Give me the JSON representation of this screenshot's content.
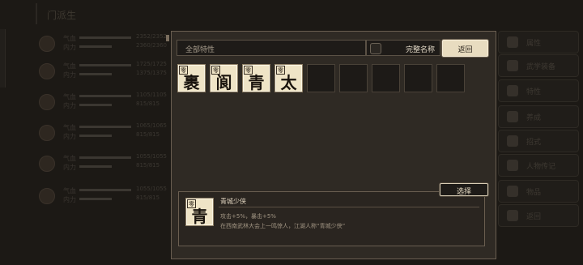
{
  "background": {
    "tab_title": "门派生",
    "rows": [
      {
        "label_a": "气血",
        "label_b": "内力",
        "num_a": "2352/2352",
        "num_b": "2360/2360"
      },
      {
        "label_a": "气血",
        "label_b": "内力",
        "num_a": "1725/1725",
        "num_b": "1375/1375"
      },
      {
        "label_a": "气血",
        "label_b": "内力",
        "num_a": "1105/1105",
        "num_b": "815/815"
      },
      {
        "label_a": "气血",
        "label_b": "内力",
        "num_a": "1065/1065",
        "num_b": "815/815"
      },
      {
        "label_a": "气血",
        "label_b": "内力",
        "num_a": "1055/1055",
        "num_b": "815/815"
      },
      {
        "label_a": "气血",
        "label_b": "内力",
        "num_a": "1055/1055",
        "num_b": "815/815"
      }
    ],
    "side_menu": [
      "属性",
      "武学装备",
      "特性",
      "养成",
      "招式",
      "人物传记",
      "物品",
      "返回"
    ]
  },
  "dialog": {
    "search_placeholder": "全部特性",
    "full_name_label": "完整名称",
    "back_label": "返回",
    "traits": [
      {
        "tag": "零",
        "char": "裹"
      },
      {
        "tag": "零",
        "char": "阆"
      },
      {
        "tag": "零",
        "char": "青"
      },
      {
        "tag": "零",
        "char": "太"
      }
    ],
    "empty_slots": 5,
    "select_label": "选择",
    "detail": {
      "tag": "零",
      "char": "青",
      "title": "青城少侠",
      "stats": "攻击+5%，暴击+5%",
      "description": "在西南武林大会上一鸣惊人，江湖人称“青城少侠”"
    }
  },
  "colors": {
    "panel": "#2f2a24",
    "tile": "#efe4c6",
    "accent": "#e8dcc0"
  }
}
